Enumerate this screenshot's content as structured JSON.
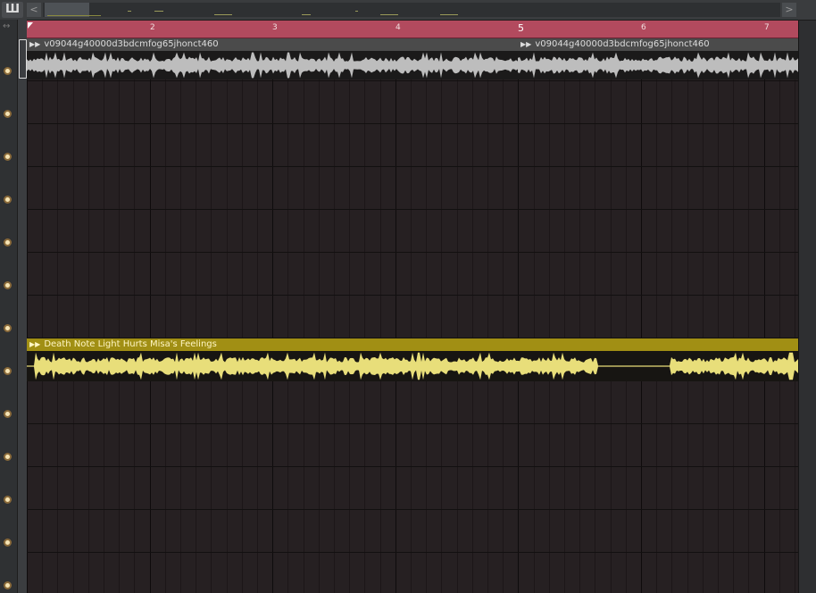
{
  "toolbar": {
    "logo_glyph": "Ш",
    "scroll_left_glyph": "<",
    "scroll_right_glyph": ">",
    "resize_glyph": "↔"
  },
  "timeline": {
    "bars": [
      "2",
      "3",
      "4",
      "5",
      "6",
      "7"
    ],
    "first_marker": "1"
  },
  "clips": [
    {
      "name": "v09044g40000d3bdcmfog65jhonct460",
      "color": "#4b4b4b"
    },
    {
      "name": "v09044g40000d3bdcmfog65jhonct460",
      "color": "#4b4b4b"
    },
    {
      "name": "Death Note Light Hurts Misa's Feelings",
      "color": "#a18f14"
    }
  ],
  "colors": {
    "timeline": "#b24a5e",
    "clip_grey": "#4b4b4b",
    "clip_yellow": "#a18f14",
    "wave_grey": "#bdbdbd",
    "wave_yellow": "#e8de7a"
  },
  "icons": {
    "track_indicator": "track-led-icon",
    "arrow": "clip-arrow-icon"
  }
}
